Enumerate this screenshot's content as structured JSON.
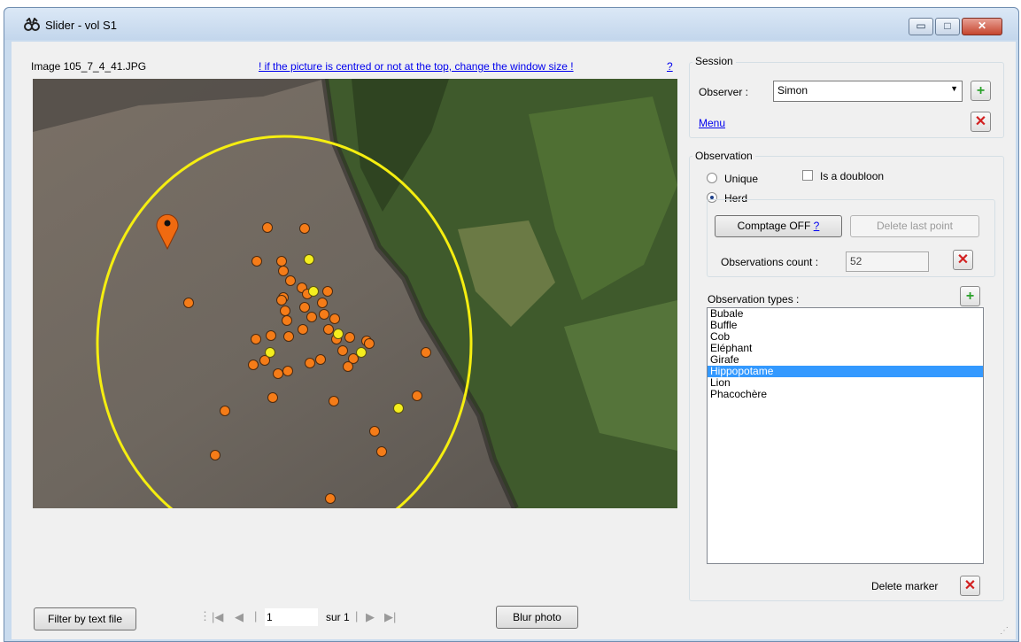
{
  "window": {
    "title": "Slider - vol S1",
    "icon": "binoculars-icon",
    "controls": {
      "minimize": "▭",
      "maximize": "□",
      "close": "✕"
    }
  },
  "image_panel": {
    "filename": "Image 105_7_4_41.JPG",
    "resize_hint": "! if the picture is centred or not at the top, change the window size !",
    "help": "?"
  },
  "session": {
    "title": "Session",
    "observer_label": "Observer :",
    "observer_value": "Simon",
    "menu_link": "Menu"
  },
  "observation": {
    "title": "Observation",
    "unique_label": "Unique",
    "doubloon_label": "Is a  doubloon",
    "herd_label": "Herd",
    "comptage_button": "Comptage OFF",
    "comptage_help": "?",
    "delete_last_point": "Delete last point",
    "count_label": "Observations count :",
    "count_value": "52",
    "types_label": "Observation types :",
    "types": [
      "Bubale",
      "Buffle",
      "Cob",
      "Eléphant",
      "Girafe",
      "Hippopotame",
      "Lion",
      "Phacochère"
    ],
    "selected_type": "Hippopotame",
    "delete_marker": "Delete marker"
  },
  "bottom": {
    "filter_button": "Filter by text file",
    "page_value": "1",
    "page_of": "sur 1",
    "blur_button": "Blur photo"
  },
  "colors": {
    "marker_orange": "#f57c18",
    "marker_yellow": "#f4ee1e",
    "circle": "#f5ee10",
    "pin": "#f06a10",
    "selection": "#3399ff"
  }
}
